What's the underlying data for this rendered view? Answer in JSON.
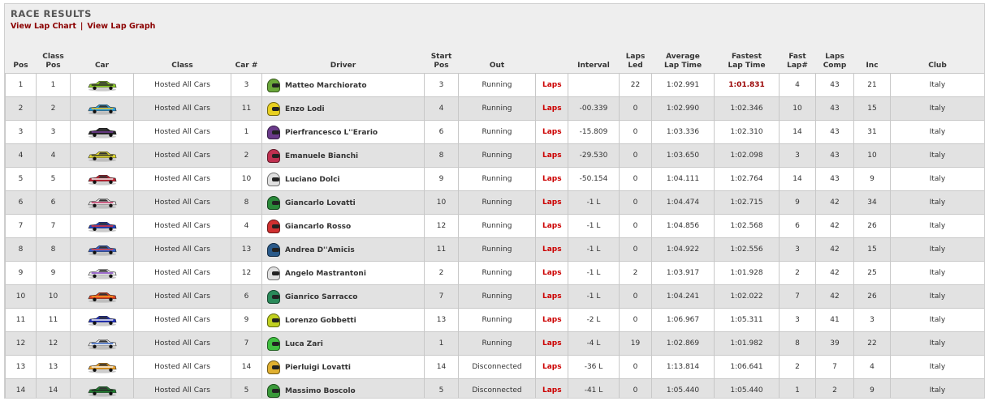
{
  "header": {
    "title": "RACE RESULTS",
    "lap_chart_link": "View Lap Chart",
    "separator": "|",
    "lap_graph_link": "View Lap Graph"
  },
  "columns": {
    "pos": "Pos",
    "class_pos_1": "Class",
    "class_pos_2": "Pos",
    "car": "Car",
    "class": "Class",
    "car_num": "Car #",
    "driver": "Driver",
    "start_pos_1": "Start",
    "start_pos_2": "Pos",
    "out": "Out",
    "interval": "Interval",
    "laps_led_1": "Laps",
    "laps_led_2": "Led",
    "avg_lap_1": "Average",
    "avg_lap_2": "Lap Time",
    "fastest_lap_1": "Fastest",
    "fastest_lap_2": "Lap Time",
    "fast_lap_num_1": "Fast",
    "fast_lap_num_2": "Lap#",
    "laps_comp_1": "Laps",
    "laps_comp_2": "Comp",
    "inc": "Inc",
    "club": "Club"
  },
  "laps_link_label": "Laps",
  "rows": [
    {
      "pos": "1",
      "class_pos": "1",
      "car_color": "#8fcf2a",
      "car_color2": "#222222",
      "class": "Hosted All Cars",
      "car_num": "3",
      "helmet": "#6aa83a",
      "driver": "Matteo Marchiorato",
      "start": "3",
      "out": "Running",
      "interval": "",
      "laps_led": "22",
      "avg": "1:02.991",
      "fastest": "1:01.831",
      "fast_lap": "4",
      "laps_comp": "43",
      "inc": "21",
      "club": "Italy"
    },
    {
      "pos": "2",
      "class_pos": "2",
      "car_color": "#2a9ee0",
      "car_color2": "#f0c020",
      "class": "Hosted All Cars",
      "car_num": "11",
      "helmet": "#e8d020",
      "driver": "Enzo Lodi",
      "start": "4",
      "out": "Running",
      "interval": "-00.339",
      "laps_led": "0",
      "avg": "1:02.990",
      "fastest": "1:02.346",
      "fast_lap": "10",
      "laps_comp": "43",
      "inc": "15",
      "club": "Italy"
    },
    {
      "pos": "3",
      "class_pos": "3",
      "car_color": "#222222",
      "car_color2": "#7a3fa0",
      "class": "Hosted All Cars",
      "car_num": "1",
      "helmet": "#6a3a8a",
      "driver": "Pierfrancesco L''Erario",
      "start": "6",
      "out": "Running",
      "interval": "-15.809",
      "laps_led": "0",
      "avg": "1:03.336",
      "fastest": "1:02.310",
      "fast_lap": "14",
      "laps_comp": "43",
      "inc": "31",
      "club": "Italy"
    },
    {
      "pos": "4",
      "class_pos": "4",
      "car_color": "#e8e030",
      "car_color2": "#333333",
      "class": "Hosted All Cars",
      "car_num": "2",
      "helmet": "#c03050",
      "driver": "Emanuele Bianchi",
      "start": "8",
      "out": "Running",
      "interval": "-29.530",
      "laps_led": "0",
      "avg": "1:03.650",
      "fastest": "1:02.098",
      "fast_lap": "3",
      "laps_comp": "43",
      "inc": "10",
      "club": "Italy"
    },
    {
      "pos": "5",
      "class_pos": "5",
      "car_color": "#c02030",
      "car_color2": "#eeeeee",
      "class": "Hosted All Cars",
      "car_num": "10",
      "helmet": "#e0e0e0",
      "driver": "Luciano Dolci",
      "start": "9",
      "out": "Running",
      "interval": "-50.154",
      "laps_led": "0",
      "avg": "1:04.111",
      "fastest": "1:02.764",
      "fast_lap": "14",
      "laps_comp": "43",
      "inc": "9",
      "club": "Italy"
    },
    {
      "pos": "6",
      "class_pos": "6",
      "car_color": "#e8e8e8",
      "car_color2": "#c03060",
      "class": "Hosted All Cars",
      "car_num": "8",
      "helmet": "#2a8a3a",
      "driver": "Giancarlo Lovatti",
      "start": "10",
      "out": "Running",
      "interval": "-1 L",
      "laps_led": "0",
      "avg": "1:04.474",
      "fastest": "1:02.715",
      "fast_lap": "9",
      "laps_comp": "42",
      "inc": "34",
      "club": "Italy"
    },
    {
      "pos": "7",
      "class_pos": "7",
      "car_color": "#2040c0",
      "car_color2": "#e03030",
      "class": "Hosted All Cars",
      "car_num": "4",
      "helmet": "#d03030",
      "driver": "Giancarlo Rosso",
      "start": "12",
      "out": "Running",
      "interval": "-1 L",
      "laps_led": "0",
      "avg": "1:04.856",
      "fastest": "1:02.568",
      "fast_lap": "6",
      "laps_comp": "42",
      "inc": "26",
      "club": "Italy"
    },
    {
      "pos": "8",
      "class_pos": "8",
      "car_color": "#3060d0",
      "car_color2": "#e04040",
      "class": "Hosted All Cars",
      "car_num": "13",
      "helmet": "#2a5a8a",
      "driver": "Andrea D''Amicis",
      "start": "11",
      "out": "Running",
      "interval": "-1 L",
      "laps_led": "0",
      "avg": "1:04.922",
      "fastest": "1:02.556",
      "fast_lap": "3",
      "laps_comp": "42",
      "inc": "15",
      "club": "Italy"
    },
    {
      "pos": "9",
      "class_pos": "9",
      "car_color": "#f0f0f0",
      "car_color2": "#8040c0",
      "class": "Hosted All Cars",
      "car_num": "12",
      "helmet": "#e0e0e0",
      "driver": "Angelo Mastrantoni",
      "start": "2",
      "out": "Running",
      "interval": "-1 L",
      "laps_led": "2",
      "avg": "1:03.917",
      "fastest": "1:01.928",
      "fast_lap": "2",
      "laps_comp": "42",
      "inc": "25",
      "club": "Italy"
    },
    {
      "pos": "10",
      "class_pos": "10",
      "car_color": "#e04020",
      "car_color2": "#f0a020",
      "class": "Hosted All Cars",
      "car_num": "6",
      "helmet": "#2a8a5a",
      "driver": "Gianrico Sarracco",
      "start": "7",
      "out": "Running",
      "interval": "-1 L",
      "laps_led": "0",
      "avg": "1:04.241",
      "fastest": "1:02.022",
      "fast_lap": "7",
      "laps_comp": "42",
      "inc": "26",
      "club": "Italy"
    },
    {
      "pos": "11",
      "class_pos": "11",
      "car_color": "#2030c0",
      "car_color2": "#eeeeee",
      "class": "Hosted All Cars",
      "car_num": "9",
      "helmet": "#c0d020",
      "driver": "Lorenzo Gobbetti",
      "start": "13",
      "out": "Running",
      "interval": "-2 L",
      "laps_led": "0",
      "avg": "1:06.967",
      "fastest": "1:05.311",
      "fast_lap": "3",
      "laps_comp": "41",
      "inc": "3",
      "club": "Italy"
    },
    {
      "pos": "12",
      "class_pos": "12",
      "car_color": "#f0f0f0",
      "car_color2": "#3060c0",
      "class": "Hosted All Cars",
      "car_num": "7",
      "helmet": "#40c040",
      "driver": "Luca Zari",
      "start": "1",
      "out": "Running",
      "interval": "-4 L",
      "laps_led": "19",
      "avg": "1:02.869",
      "fastest": "1:01.982",
      "fast_lap": "8",
      "laps_comp": "39",
      "inc": "22",
      "club": "Italy"
    },
    {
      "pos": "13",
      "class_pos": "13",
      "car_color": "#f0a020",
      "car_color2": "#f0f0f0",
      "class": "Hosted All Cars",
      "car_num": "14",
      "helmet": "#e0b030",
      "driver": "Pierluigi Lovatti",
      "start": "14",
      "out": "Disconnected",
      "interval": "-36 L",
      "laps_led": "0",
      "avg": "1:13.814",
      "fastest": "1:06.641",
      "fast_lap": "2",
      "laps_comp": "7",
      "inc": "4",
      "club": "Italy"
    },
    {
      "pos": "14",
      "class_pos": "14",
      "car_color": "#208030",
      "car_color2": "#222222",
      "class": "Hosted All Cars",
      "car_num": "5",
      "helmet": "#3a9a3a",
      "driver": "Massimo Boscolo",
      "start": "5",
      "out": "Disconnected",
      "interval": "-41 L",
      "laps_led": "0",
      "avg": "1:05.440",
      "fastest": "1:05.440",
      "fast_lap": "1",
      "laps_comp": "2",
      "inc": "9",
      "club": "Italy"
    }
  ]
}
